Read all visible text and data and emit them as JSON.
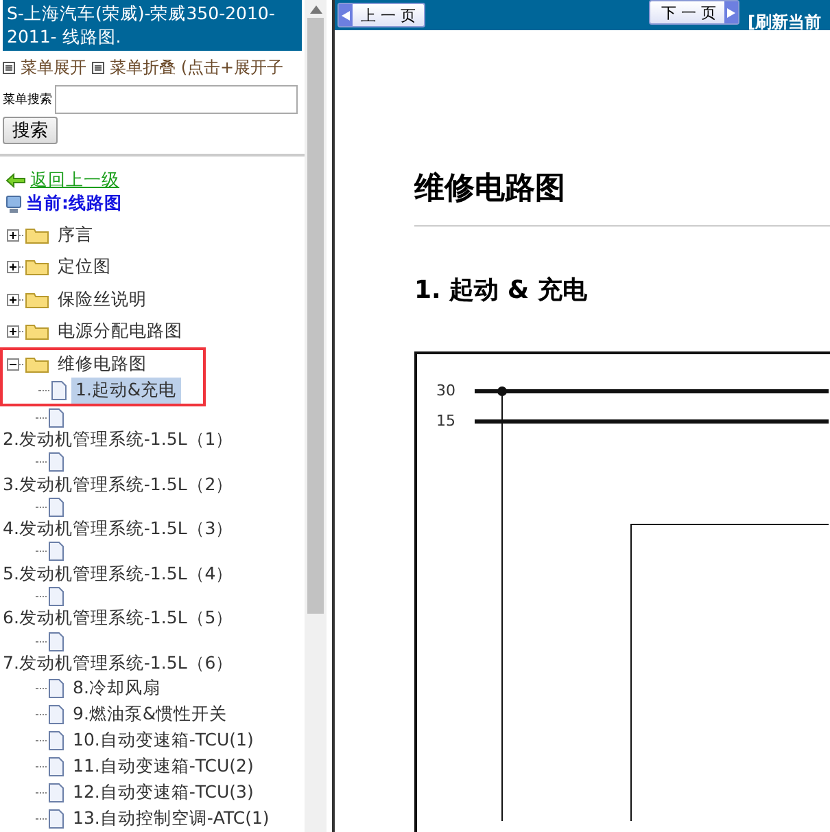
{
  "sidebar": {
    "title": "S-上海汽车(荣威)-荣威350-2010-2011- 线路图.",
    "menu_controls": [
      {
        "label": "菜单展开"
      },
      {
        "label": "菜单折叠 (点击+展开子"
      }
    ],
    "search": {
      "label": "菜单搜索",
      "button": "搜索"
    },
    "back_link": "返回上一级",
    "current": "当前:线路图",
    "tree": [
      {
        "kind": "folder",
        "label": "序言",
        "expanded": false,
        "outlined": false
      },
      {
        "kind": "folder",
        "label": "定位图",
        "expanded": false,
        "outlined": false
      },
      {
        "kind": "folder",
        "label": "保险丝说明",
        "expanded": false,
        "outlined": false
      },
      {
        "kind": "folder",
        "label": "电源分配电路图",
        "expanded": false,
        "outlined": false
      },
      {
        "kind": "folder",
        "label": "维修电路图",
        "expanded": true,
        "outlined": true,
        "children": [
          {
            "kind": "page",
            "label": "1.起动&充电",
            "selected": true
          },
          {
            "kind": "page",
            "selected": false
          },
          {
            "kind": "heading",
            "label": "2.发动机管理系统-1.5L（1）"
          },
          {
            "kind": "page",
            "selected": false
          },
          {
            "kind": "heading",
            "label": "3.发动机管理系统-1.5L（2）"
          },
          {
            "kind": "page",
            "selected": false
          },
          {
            "kind": "heading",
            "label": "4.发动机管理系统-1.5L（3）"
          },
          {
            "kind": "page",
            "selected": false
          },
          {
            "kind": "heading",
            "label": "5.发动机管理系统-1.5L（4）"
          },
          {
            "kind": "page",
            "selected": false
          },
          {
            "kind": "heading",
            "label": "6.发动机管理系统-1.5L（5）"
          },
          {
            "kind": "page",
            "selected": false
          },
          {
            "kind": "heading",
            "label": "7.发动机管理系统-1.5L（6）"
          },
          {
            "kind": "page",
            "label": "8.冷却风扇",
            "selected": false
          },
          {
            "kind": "page",
            "label": "9.燃油泵&惯性开关",
            "selected": false
          },
          {
            "kind": "page",
            "label": "10.自动变速箱-TCU(1)",
            "selected": false
          },
          {
            "kind": "page",
            "label": "11.自动变速箱-TCU(2)",
            "selected": false
          },
          {
            "kind": "page",
            "label": "12.自动变速箱-TCU(3)",
            "selected": false
          },
          {
            "kind": "page",
            "label": "13.自动控制空调-ATC(1)",
            "selected": false
          }
        ]
      }
    ]
  },
  "content": {
    "nav": {
      "prev": "上 一 页",
      "next": "下 一 页",
      "refresh": "[刷新当前"
    },
    "heading": "维修电路图",
    "section": "1.  起动 & 充电",
    "diagram": {
      "wires": [
        {
          "label": "30"
        },
        {
          "label": "15"
        }
      ]
    }
  }
}
